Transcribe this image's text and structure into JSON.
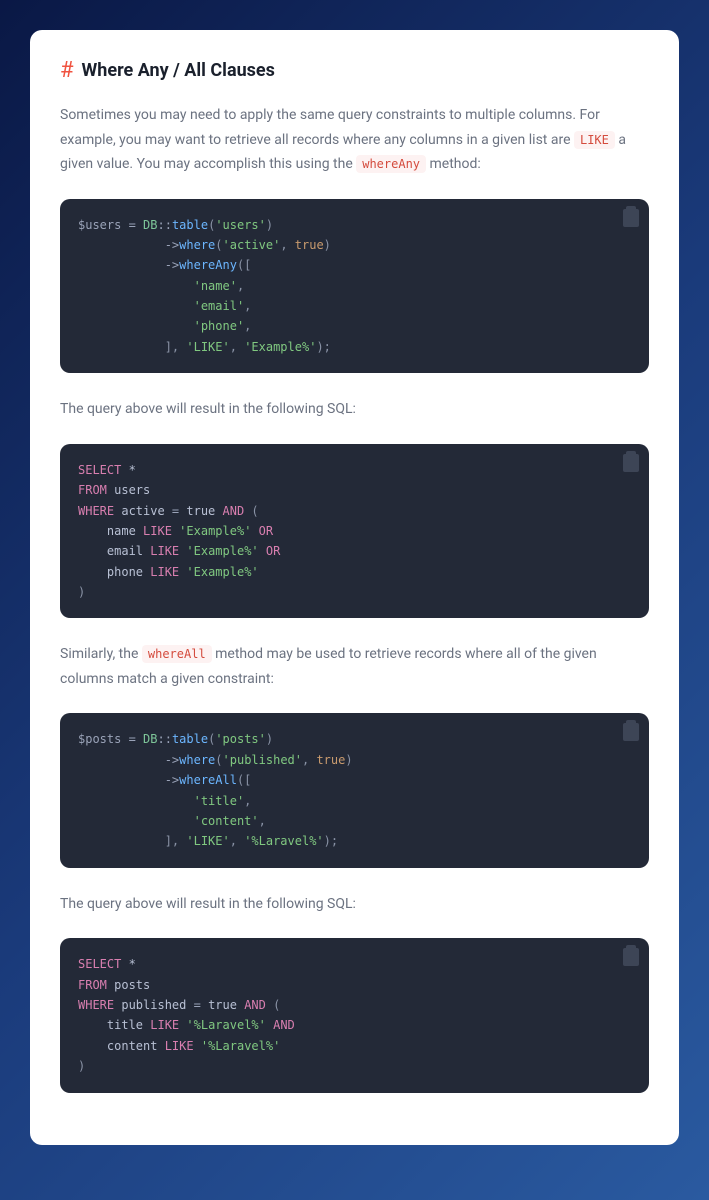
{
  "heading": {
    "hash": "#",
    "title": "Where Any / All Clauses"
  },
  "p1": {
    "t1": "Sometimes you may need to apply the same query constraints to multiple columns. For example, you may want to retrieve all records where any columns in a given list are ",
    "c1": "LIKE",
    "t2": " a given value. You may accomplish this using the ",
    "c2": "whereAny",
    "t3": " method:"
  },
  "code1": {
    "l1a": "$users",
    "l1b": " = ",
    "l1c": "DB",
    "l1d": "::",
    "l1e": "table",
    "l1f": "(",
    "l1g": "'users'",
    "l1h": ")",
    "l2a": "            ->",
    "l2b": "where",
    "l2c": "(",
    "l2d": "'active'",
    "l2e": ", ",
    "l2f": "true",
    "l2g": ")",
    "l3a": "            ->",
    "l3b": "whereAny",
    "l3c": "([",
    "l4a": "                ",
    "l4b": "'name'",
    "l4c": ",",
    "l5a": "                ",
    "l5b": "'email'",
    "l5c": ",",
    "l6a": "                ",
    "l6b": "'phone'",
    "l6c": ",",
    "l7a": "            ], ",
    "l7b": "'LIKE'",
    "l7c": ", ",
    "l7d": "'Example%'",
    "l7e": ");"
  },
  "p2": "The query above will result in the following SQL:",
  "code2": {
    "l1a": "SELECT",
    "l1b": " *",
    "l2a": "FROM",
    "l2b": " users",
    "l3a": "WHERE",
    "l3b": " active ",
    "l3c": "=",
    "l3d": " true ",
    "l3e": "AND",
    "l3f": " (",
    "l4a": "    name ",
    "l4b": "LIKE",
    "l4c": " ",
    "l4d": "'Example%'",
    "l4e": " ",
    "l4f": "OR",
    "l5a": "    email ",
    "l5b": "LIKE",
    "l5c": " ",
    "l5d": "'Example%'",
    "l5e": " ",
    "l5f": "OR",
    "l6a": "    phone ",
    "l6b": "LIKE",
    "l6c": " ",
    "l6d": "'Example%'",
    "l7": ")"
  },
  "p3": {
    "t1": "Similarly, the ",
    "c1": "whereAll",
    "t2": " method may be used to retrieve records where all of the given columns match a given constraint:"
  },
  "code3": {
    "l1a": "$posts",
    "l1b": " = ",
    "l1c": "DB",
    "l1d": "::",
    "l1e": "table",
    "l1f": "(",
    "l1g": "'posts'",
    "l1h": ")",
    "l2a": "            ->",
    "l2b": "where",
    "l2c": "(",
    "l2d": "'published'",
    "l2e": ", ",
    "l2f": "true",
    "l2g": ")",
    "l3a": "            ->",
    "l3b": "whereAll",
    "l3c": "([",
    "l4a": "                ",
    "l4b": "'title'",
    "l4c": ",",
    "l5a": "                ",
    "l5b": "'content'",
    "l5c": ",",
    "l6a": "            ], ",
    "l6b": "'LIKE'",
    "l6c": ", ",
    "l6d": "'%Laravel%'",
    "l6e": ");"
  },
  "p4": "The query above will result in the following SQL:",
  "code4": {
    "l1a": "SELECT",
    "l1b": " *",
    "l2a": "FROM",
    "l2b": " posts",
    "l3a": "WHERE",
    "l3b": " published ",
    "l3c": "=",
    "l3d": " true ",
    "l3e": "AND",
    "l3f": " (",
    "l4a": "    title ",
    "l4b": "LIKE",
    "l4c": " ",
    "l4d": "'%Laravel%'",
    "l4e": " ",
    "l4f": "AND",
    "l5a": "    content ",
    "l5b": "LIKE",
    "l5c": " ",
    "l5d": "'%Laravel%'",
    "l6": ")"
  }
}
